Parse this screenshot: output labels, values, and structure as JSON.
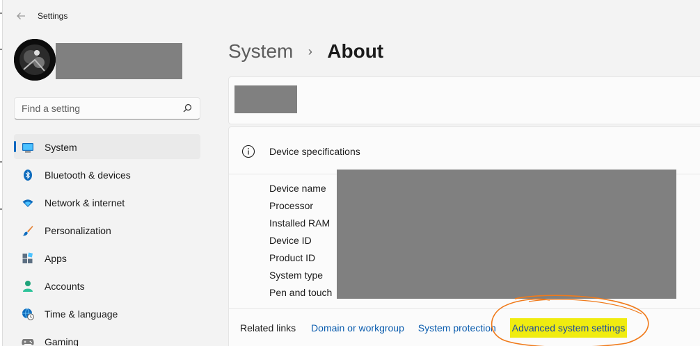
{
  "window": {
    "title": "Settings"
  },
  "search": {
    "placeholder": "Find a setting"
  },
  "sidebar": {
    "items": [
      {
        "label": "System",
        "icon": "system-monitor-icon",
        "active": true
      },
      {
        "label": "Bluetooth & devices",
        "icon": "bluetooth-icon"
      },
      {
        "label": "Network & internet",
        "icon": "wifi-icon"
      },
      {
        "label": "Personalization",
        "icon": "brush-icon"
      },
      {
        "label": "Apps",
        "icon": "apps-icon"
      },
      {
        "label": "Accounts",
        "icon": "person-icon"
      },
      {
        "label": "Time & language",
        "icon": "globe-clock-icon"
      },
      {
        "label": "Gaming",
        "icon": "gamepad-icon"
      }
    ]
  },
  "breadcrumb": {
    "parent": "System",
    "separator": "›",
    "current": "About"
  },
  "device_specs": {
    "title": "Device specifications",
    "labels": [
      "Device name",
      "Processor",
      "Installed RAM",
      "Device ID",
      "Product ID",
      "System type",
      "Pen and touch"
    ]
  },
  "related_links": {
    "title": "Related links",
    "links": [
      "Domain or workgroup",
      "System protection",
      "Advanced system settings"
    ]
  },
  "colors": {
    "accent": "#0067c0",
    "link": "#0a5cae",
    "highlight": "#f0ec10",
    "annotation": "#f07a1a",
    "redaction": "#808080"
  }
}
